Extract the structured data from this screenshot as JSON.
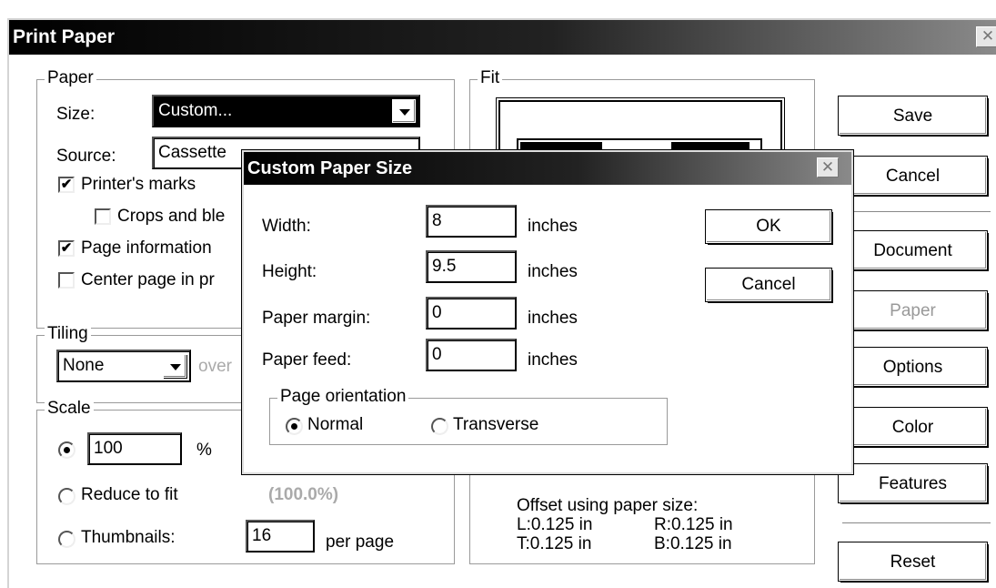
{
  "window": {
    "title": "Print Paper",
    "close_glyph": "✕"
  },
  "paper_group": {
    "legend": "Paper",
    "size_label": "Size:",
    "size_value": "Custom...",
    "source_label": "Source:",
    "source_value": "Cassette",
    "printers_marks": {
      "label": "Printer's marks",
      "checked": true
    },
    "crops_label": "Crops and ble",
    "page_information": {
      "label": "Page information",
      "checked": true
    },
    "center_page_label": "Center page in pr"
  },
  "tiling_group": {
    "legend": "Tiling",
    "value": "None",
    "overlap_partial": "over"
  },
  "scale_group": {
    "legend": "Scale",
    "percent_value": "100",
    "percent_symbol": "%",
    "reduce_label": "Reduce to fit",
    "reduce_value": "(100.0%)",
    "thumbnails_label": "Thumbnails:",
    "thumbnails_value": "16",
    "per_page_label": "per page"
  },
  "fit_group": {
    "legend": "Fit",
    "offset_heading": "Offset using paper size:",
    "offset_left": "L:0.125 in",
    "offset_right": "R:0.125 in",
    "offset_top": "T:0.125 in",
    "offset_bottom": "B:0.125 in"
  },
  "side_buttons": {
    "save": "Save",
    "cancel": "Cancel",
    "document": "Document",
    "paper": "Paper",
    "options": "Options",
    "color": "Color",
    "features": "Features",
    "reset": "Reset"
  },
  "custom_dialog": {
    "title": "Custom Paper Size",
    "close_glyph": "✕",
    "width_label": "Width:",
    "width_value": "8",
    "height_label": "Height:",
    "height_value": "9.5",
    "margin_label": "Paper margin:",
    "margin_value": "0",
    "feed_label": "Paper feed:",
    "feed_value": "0",
    "unit": "inches",
    "ok_label": "OK",
    "cancel_label": "Cancel",
    "orientation_legend": "Page orientation",
    "normal_label": "Normal",
    "transverse_label": "Transverse",
    "selected_orientation": "Normal"
  }
}
